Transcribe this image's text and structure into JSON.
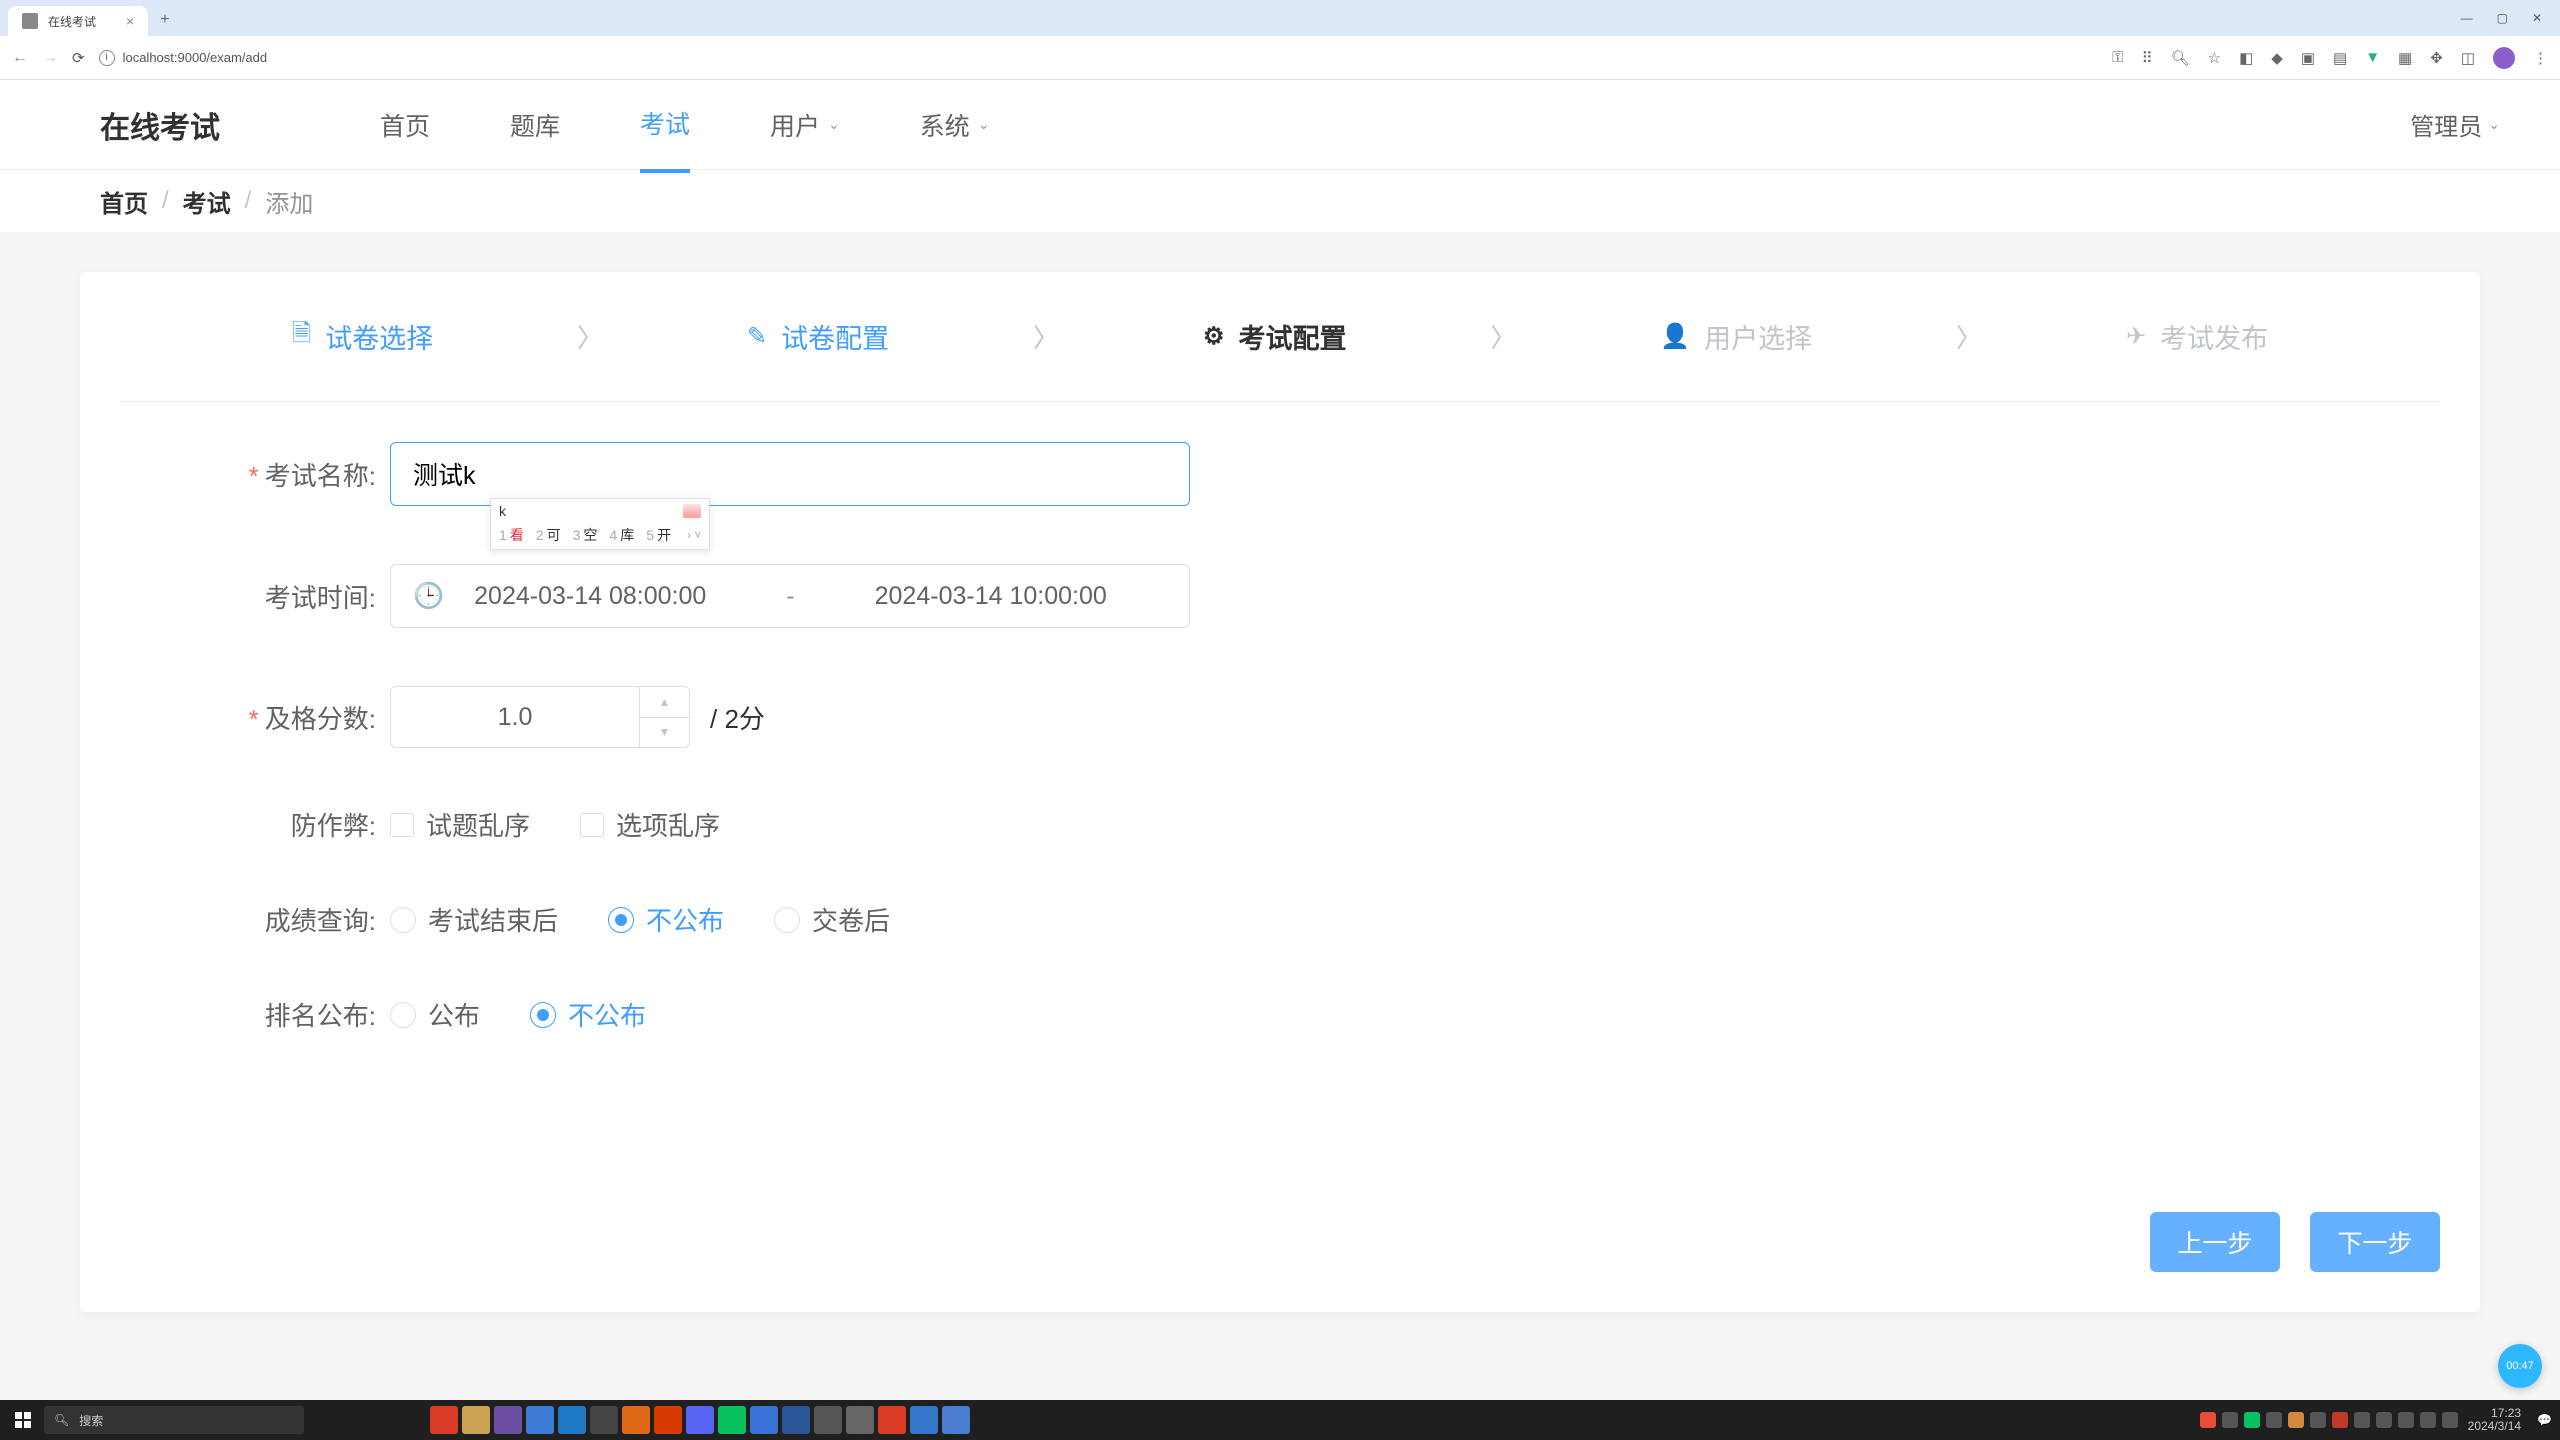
{
  "browser": {
    "tab_title": "在线考试",
    "url": "localhost:9000/exam/add"
  },
  "header": {
    "logo": "在线考试",
    "nav": {
      "home": "首页",
      "bank": "题库",
      "exam": "考试",
      "user": "用户",
      "system": "系统"
    },
    "user_menu": "管理员"
  },
  "breadcrumb": {
    "home": "首页",
    "exam": "考试",
    "add": "添加"
  },
  "steps": {
    "s1": "试卷选择",
    "s2": "试卷配置",
    "s3": "考试配置",
    "s4": "用户选择",
    "s5": "考试发布"
  },
  "form": {
    "name_label": "考试名称:",
    "name_value": "测试k",
    "time_label": "考试时间:",
    "time_start": "2024-03-14 08:00:00",
    "time_sep": "-",
    "time_end": "2024-03-14 10:00:00",
    "pass_label": "及格分数:",
    "pass_value": "1.0",
    "pass_suffix": "/ 2分",
    "anti_label": "防作弊:",
    "anti_q": "试题乱序",
    "anti_o": "选项乱序",
    "score_label": "成绩查询:",
    "score_after": "考试结束后",
    "score_hide": "不公布",
    "score_submit": "交卷后",
    "rank_label": "排名公布:",
    "rank_show": "公布",
    "rank_hide": "不公布"
  },
  "ime": {
    "pinyin": "k",
    "candidates": [
      {
        "n": "1",
        "w": "看"
      },
      {
        "n": "2",
        "w": "可"
      },
      {
        "n": "3",
        "w": "空"
      },
      {
        "n": "4",
        "w": "库"
      },
      {
        "n": "5",
        "w": "开"
      }
    ]
  },
  "buttons": {
    "prev": "上一步",
    "next": "下一步"
  },
  "taskbar": {
    "search": "搜索",
    "time": "17:23",
    "date": "2024/3/14"
  },
  "float": {
    "text": "00:47"
  }
}
